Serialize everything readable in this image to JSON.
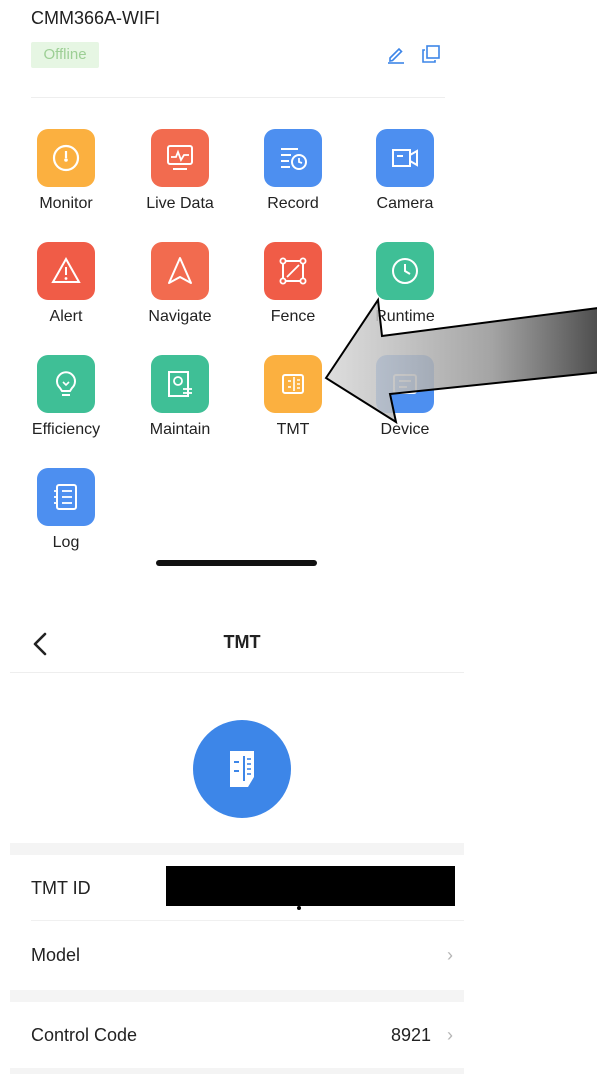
{
  "header": {
    "device_name": "CMM366A-WIFI",
    "status": "Offline"
  },
  "grid": {
    "items": [
      {
        "label": "Monitor",
        "color": "#fbb040",
        "icon": "gauge-icon"
      },
      {
        "label": "Live Data",
        "color": "#f26b4f",
        "icon": "chart-monitor-icon"
      },
      {
        "label": "Record",
        "color": "#4d8ff0",
        "icon": "record-clock-icon"
      },
      {
        "label": "Camera",
        "color": "#4d8ff0",
        "icon": "camera-icon"
      },
      {
        "label": "Alert",
        "color": "#f05c47",
        "icon": "alert-triangle-icon"
      },
      {
        "label": "Navigate",
        "color": "#f26b4f",
        "icon": "navigate-arrow-icon"
      },
      {
        "label": "Fence",
        "color": "#f05c47",
        "icon": "fence-square-icon"
      },
      {
        "label": "Runtime",
        "color": "#3fbf96",
        "icon": "clock-icon"
      },
      {
        "label": "Efficiency",
        "color": "#3fbf96",
        "icon": "lightbulb-icon"
      },
      {
        "label": "Maintain",
        "color": "#3fbf96",
        "icon": "maintain-doc-icon"
      },
      {
        "label": "TMT",
        "color": "#fbb040",
        "icon": "tmt-icon"
      },
      {
        "label": "Device",
        "color": "#4d8ff0",
        "icon": "device-icon"
      },
      {
        "label": "Log",
        "color": "#4d8ff0",
        "icon": "log-list-icon"
      }
    ]
  },
  "detail": {
    "title": "TMT",
    "hero_color": "#3d86e8",
    "rows": [
      {
        "label": "TMT ID",
        "value": ""
      },
      {
        "label": "Model",
        "value": ""
      },
      {
        "label": "Control Code",
        "value": "8921"
      }
    ]
  }
}
